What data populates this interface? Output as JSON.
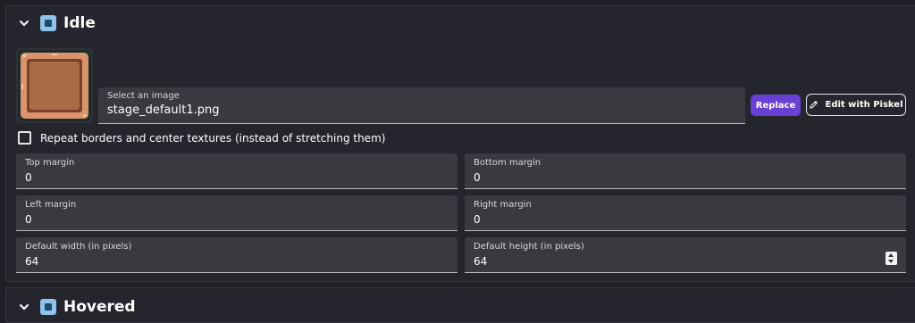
{
  "idle_section": {
    "title": "Idle",
    "image_field": {
      "label": "Select an image",
      "value": "stage_default1.png"
    },
    "replace_label": "Replace",
    "edit_piskel_label": "Edit with Piskel",
    "repeat_borders_label": "Repeat borders and center textures (instead of stretching them)",
    "repeat_borders_checked": false,
    "top_margin": {
      "label": "Top margin",
      "value": "0"
    },
    "bottom_margin": {
      "label": "Bottom margin",
      "value": "0"
    },
    "left_margin": {
      "label": "Left margin",
      "value": "0"
    },
    "right_margin": {
      "label": "Right margin",
      "value": "0"
    },
    "default_width": {
      "label": "Default width (in pixels)",
      "value": "64"
    },
    "default_height": {
      "label": "Default height (in pixels)",
      "value": "64"
    }
  },
  "hovered_section": {
    "title": "Hovered"
  },
  "icons": {
    "collapse": "chevron-down-icon",
    "section": "object-icon",
    "edit": "pencil-icon",
    "spinner": "number-spinner-icon"
  },
  "colors": {
    "background": "#1e1e24",
    "panel": "#25252d",
    "field": "#3a393f",
    "accent": "#6a3fd4",
    "thumb_frame": "#d9946b",
    "thumb_center": "#a86b47"
  }
}
